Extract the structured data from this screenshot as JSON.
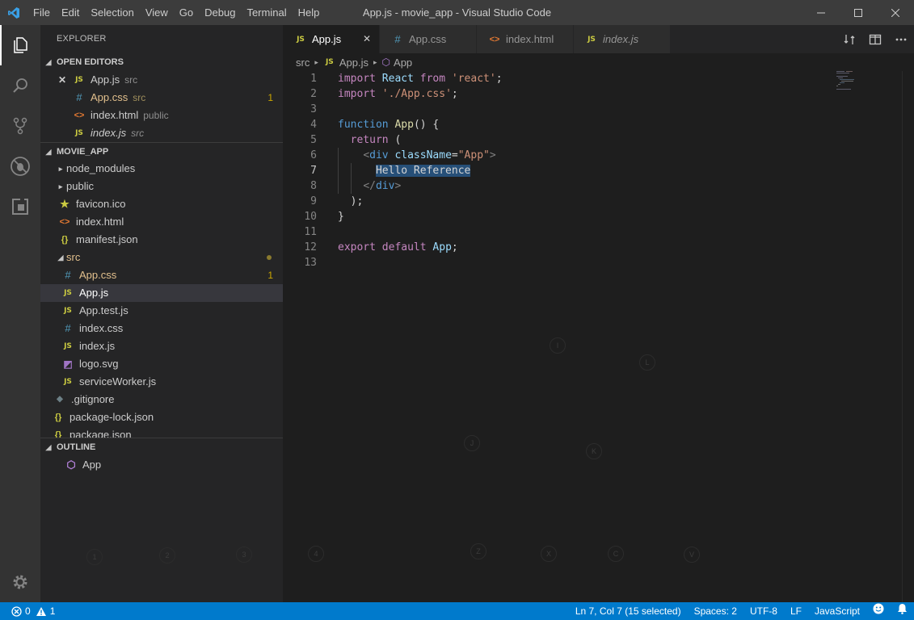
{
  "window": {
    "title": "App.js - movie_app - Visual Studio Code",
    "menu": [
      "File",
      "Edit",
      "Selection",
      "View",
      "Go",
      "Debug",
      "Terminal",
      "Help"
    ]
  },
  "sidebar": {
    "title": "EXPLORER",
    "open_editors": {
      "header": "OPEN EDITORS",
      "items": [
        {
          "icon": "JS",
          "name": "App.js",
          "desc": "src"
        },
        {
          "icon": "#",
          "name": "App.css",
          "desc": "src",
          "badge": "1"
        },
        {
          "icon": "<>",
          "name": "index.html",
          "desc": "public"
        },
        {
          "icon": "JS",
          "name": "index.js",
          "desc": "src"
        }
      ]
    },
    "project": {
      "header": "MOVIE_APP",
      "items": [
        {
          "name": "node_modules"
        },
        {
          "name": "public"
        },
        {
          "name": "favicon.ico"
        },
        {
          "name": "index.html"
        },
        {
          "name": "manifest.json"
        },
        {
          "name": "src"
        },
        {
          "name": "App.css",
          "badge": "1"
        },
        {
          "name": "App.js"
        },
        {
          "name": "App.test.js"
        },
        {
          "name": "index.css"
        },
        {
          "name": "index.js"
        },
        {
          "name": "logo.svg"
        },
        {
          "name": "serviceWorker.js"
        },
        {
          "name": ".gitignore"
        },
        {
          "name": "package-lock.json"
        },
        {
          "name": "package.json"
        }
      ]
    },
    "outline": {
      "header": "OUTLINE",
      "items": [
        {
          "name": "App"
        }
      ]
    }
  },
  "tabs": [
    {
      "icon": "JS",
      "label": "App.js"
    },
    {
      "icon": "#",
      "label": "App.css"
    },
    {
      "icon": "<>",
      "label": "index.html"
    },
    {
      "icon": "JS",
      "label": "index.js"
    }
  ],
  "breadcrumb": {
    "folder": "src",
    "file": "App.js",
    "symbol": "App"
  },
  "code": {
    "line_numbers": [
      "1",
      "2",
      "3",
      "4",
      "5",
      "6",
      "7",
      "8",
      "9",
      "10",
      "11",
      "12",
      "13"
    ],
    "current_line": "7",
    "selected_text": "Hello Reference",
    "lines": [
      "import React from 'react';",
      "import './App.css';",
      "",
      "function App() {",
      "  return (",
      "    <div className=\"App\">",
      "      Hello Reference",
      "    </div>",
      "  );",
      "}",
      "",
      "export default App;",
      ""
    ]
  },
  "ghost_keys": [
    "I",
    "L",
    "J",
    "K",
    "1",
    "2",
    "3",
    "4",
    "Z",
    "X",
    "C",
    "V"
  ],
  "statusbar": {
    "errors": "0",
    "warnings": "1",
    "position": "Ln 7, Col 7 (15 selected)",
    "spaces": "Spaces: 2",
    "encoding": "UTF-8",
    "eol": "LF",
    "language": "JavaScript"
  },
  "colors": {
    "accent": "#007acc",
    "js_icon": "#cbcb41",
    "css_icon": "#519aba",
    "html_icon": "#e37933",
    "modified": "#e2c08d"
  }
}
